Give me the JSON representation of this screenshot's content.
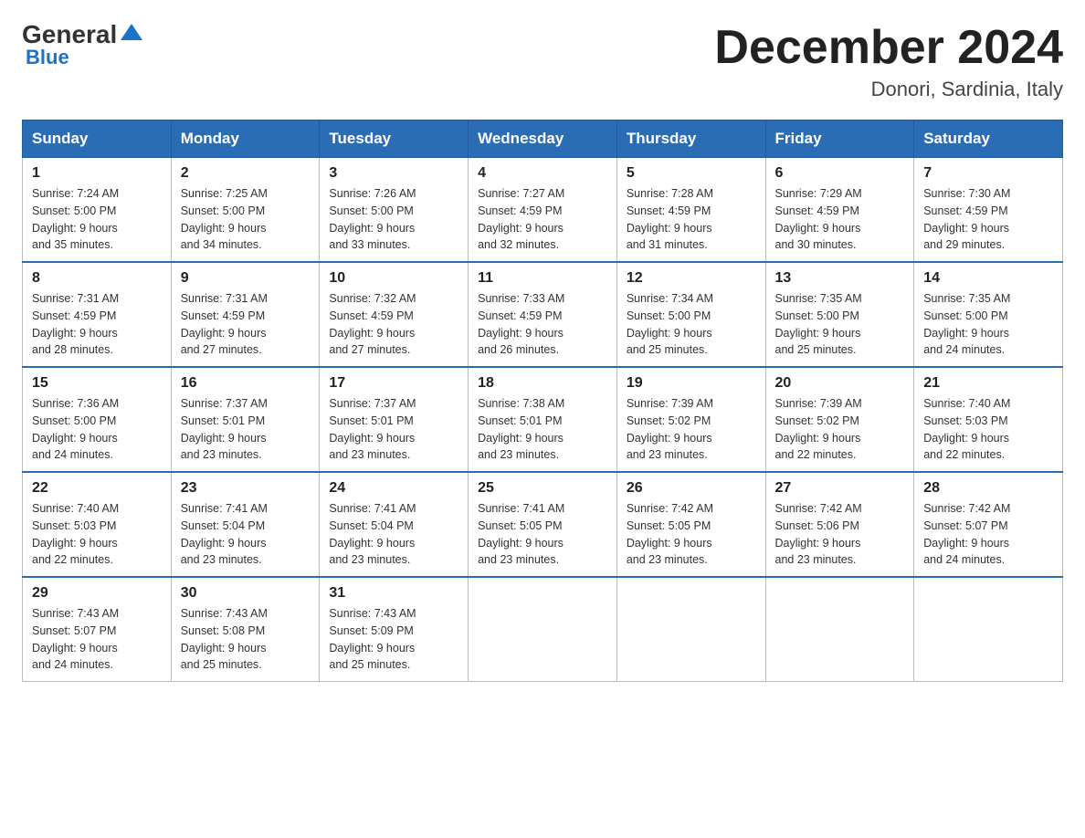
{
  "header": {
    "logo_general": "General",
    "logo_blue": "Blue",
    "month_title": "December 2024",
    "location": "Donori, Sardinia, Italy"
  },
  "weekdays": [
    "Sunday",
    "Monday",
    "Tuesday",
    "Wednesday",
    "Thursday",
    "Friday",
    "Saturday"
  ],
  "weeks": [
    [
      {
        "day": "1",
        "sunrise": "7:24 AM",
        "sunset": "5:00 PM",
        "daylight": "9 hours and 35 minutes."
      },
      {
        "day": "2",
        "sunrise": "7:25 AM",
        "sunset": "5:00 PM",
        "daylight": "9 hours and 34 minutes."
      },
      {
        "day": "3",
        "sunrise": "7:26 AM",
        "sunset": "5:00 PM",
        "daylight": "9 hours and 33 minutes."
      },
      {
        "day": "4",
        "sunrise": "7:27 AM",
        "sunset": "4:59 PM",
        "daylight": "9 hours and 32 minutes."
      },
      {
        "day": "5",
        "sunrise": "7:28 AM",
        "sunset": "4:59 PM",
        "daylight": "9 hours and 31 minutes."
      },
      {
        "day": "6",
        "sunrise": "7:29 AM",
        "sunset": "4:59 PM",
        "daylight": "9 hours and 30 minutes."
      },
      {
        "day": "7",
        "sunrise": "7:30 AM",
        "sunset": "4:59 PM",
        "daylight": "9 hours and 29 minutes."
      }
    ],
    [
      {
        "day": "8",
        "sunrise": "7:31 AM",
        "sunset": "4:59 PM",
        "daylight": "9 hours and 28 minutes."
      },
      {
        "day": "9",
        "sunrise": "7:31 AM",
        "sunset": "4:59 PM",
        "daylight": "9 hours and 27 minutes."
      },
      {
        "day": "10",
        "sunrise": "7:32 AM",
        "sunset": "4:59 PM",
        "daylight": "9 hours and 27 minutes."
      },
      {
        "day": "11",
        "sunrise": "7:33 AM",
        "sunset": "4:59 PM",
        "daylight": "9 hours and 26 minutes."
      },
      {
        "day": "12",
        "sunrise": "7:34 AM",
        "sunset": "5:00 PM",
        "daylight": "9 hours and 25 minutes."
      },
      {
        "day": "13",
        "sunrise": "7:35 AM",
        "sunset": "5:00 PM",
        "daylight": "9 hours and 25 minutes."
      },
      {
        "day": "14",
        "sunrise": "7:35 AM",
        "sunset": "5:00 PM",
        "daylight": "9 hours and 24 minutes."
      }
    ],
    [
      {
        "day": "15",
        "sunrise": "7:36 AM",
        "sunset": "5:00 PM",
        "daylight": "9 hours and 24 minutes."
      },
      {
        "day": "16",
        "sunrise": "7:37 AM",
        "sunset": "5:01 PM",
        "daylight": "9 hours and 23 minutes."
      },
      {
        "day": "17",
        "sunrise": "7:37 AM",
        "sunset": "5:01 PM",
        "daylight": "9 hours and 23 minutes."
      },
      {
        "day": "18",
        "sunrise": "7:38 AM",
        "sunset": "5:01 PM",
        "daylight": "9 hours and 23 minutes."
      },
      {
        "day": "19",
        "sunrise": "7:39 AM",
        "sunset": "5:02 PM",
        "daylight": "9 hours and 23 minutes."
      },
      {
        "day": "20",
        "sunrise": "7:39 AM",
        "sunset": "5:02 PM",
        "daylight": "9 hours and 22 minutes."
      },
      {
        "day": "21",
        "sunrise": "7:40 AM",
        "sunset": "5:03 PM",
        "daylight": "9 hours and 22 minutes."
      }
    ],
    [
      {
        "day": "22",
        "sunrise": "7:40 AM",
        "sunset": "5:03 PM",
        "daylight": "9 hours and 22 minutes."
      },
      {
        "day": "23",
        "sunrise": "7:41 AM",
        "sunset": "5:04 PM",
        "daylight": "9 hours and 23 minutes."
      },
      {
        "day": "24",
        "sunrise": "7:41 AM",
        "sunset": "5:04 PM",
        "daylight": "9 hours and 23 minutes."
      },
      {
        "day": "25",
        "sunrise": "7:41 AM",
        "sunset": "5:05 PM",
        "daylight": "9 hours and 23 minutes."
      },
      {
        "day": "26",
        "sunrise": "7:42 AM",
        "sunset": "5:05 PM",
        "daylight": "9 hours and 23 minutes."
      },
      {
        "day": "27",
        "sunrise": "7:42 AM",
        "sunset": "5:06 PM",
        "daylight": "9 hours and 23 minutes."
      },
      {
        "day": "28",
        "sunrise": "7:42 AM",
        "sunset": "5:07 PM",
        "daylight": "9 hours and 24 minutes."
      }
    ],
    [
      {
        "day": "29",
        "sunrise": "7:43 AM",
        "sunset": "5:07 PM",
        "daylight": "9 hours and 24 minutes."
      },
      {
        "day": "30",
        "sunrise": "7:43 AM",
        "sunset": "5:08 PM",
        "daylight": "9 hours and 25 minutes."
      },
      {
        "day": "31",
        "sunrise": "7:43 AM",
        "sunset": "5:09 PM",
        "daylight": "9 hours and 25 minutes."
      },
      null,
      null,
      null,
      null
    ]
  ],
  "labels": {
    "sunrise": "Sunrise:",
    "sunset": "Sunset:",
    "daylight": "Daylight:"
  }
}
